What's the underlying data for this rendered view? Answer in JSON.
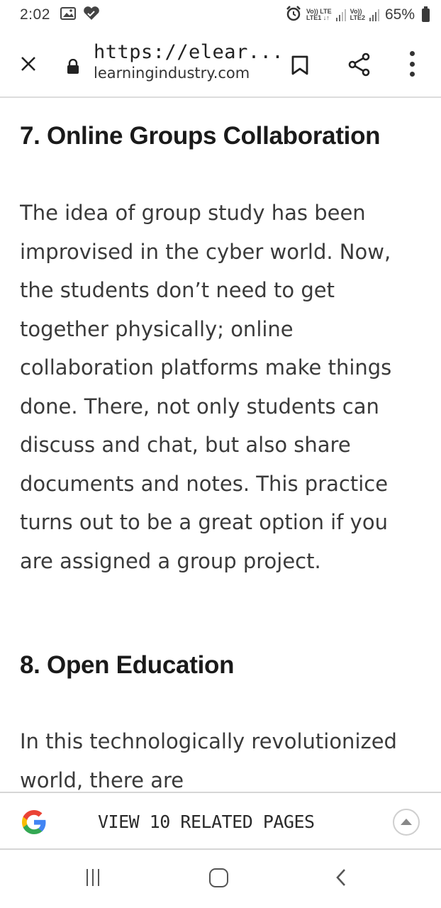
{
  "status_bar": {
    "time": "2:02",
    "net1_top": "Vo)) LTE",
    "net1_bottom": "LTE1 ↓↑",
    "net2_top": "Vo))",
    "net2_bottom": "LTE2",
    "battery": "65%",
    "icons": [
      "image-icon",
      "heart-icon",
      "alarm-icon",
      "signal-icon",
      "battery-icon"
    ]
  },
  "toolbar": {
    "url": "https://elear...",
    "domain": "learningindustry.com",
    "icons": [
      "close-icon",
      "lock-icon",
      "bookmark-icon",
      "share-icon",
      "more-vert-icon"
    ]
  },
  "article": {
    "sections": [
      {
        "heading": "7. Online Groups Collaboration",
        "body": "The idea of group study has been improvised in the cyber world. Now, the students don’t need to get together physically; online collaboration platforms make things done. There, not only students can discuss and chat, but also share documents and notes. This practice turns out to be a great option if you are assigned a group project."
      },
      {
        "heading": "8. Open Education",
        "body": "In this technologically revolutionized world, there are"
      }
    ]
  },
  "related": {
    "label": "VIEW 10 RELATED PAGES",
    "icons": [
      "google-logo-icon",
      "expand-up-icon"
    ],
    "colors": {
      "google_blue": "#4285F4",
      "google_red": "#EA4335",
      "google_yellow": "#FBBC05",
      "google_green": "#34A853"
    }
  },
  "nav": {
    "icons": [
      "recent-apps-icon",
      "home-icon",
      "back-icon"
    ]
  }
}
